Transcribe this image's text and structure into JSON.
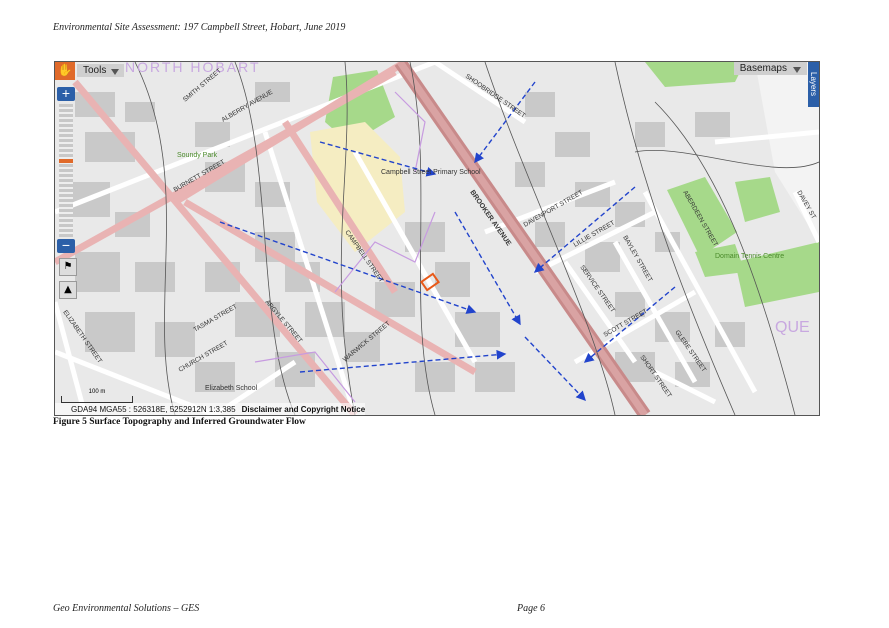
{
  "header": "Environmental Site Assessment: 197 Campbell Street, Hobart, June 2019",
  "caption": "Figure 5  Surface Topography and Inferred Groundwater Flow",
  "footer": {
    "left": "Geo Environmental Solutions – GES",
    "right": "Page 6"
  },
  "map": {
    "toolbar": {
      "tools_label": "Tools",
      "basemaps_label": "Basemaps",
      "layers_label": "Layers",
      "zoom_in": "+",
      "zoom_out": "−"
    },
    "zoom_level_fraction": 0.57,
    "status": {
      "coords": "GDA94 MGA55 : 526318E, 5252912N 1:3,385",
      "disclaimer": "Disclaimer and Copyright Notice"
    },
    "scale_label": "100 m",
    "streets": [
      "SMITH STREET",
      "ALBERRY AVENUE",
      "BURNETT STREET",
      "CAMPBELL STREET",
      "WARWICK STREET",
      "ARGYLE STREET",
      "TASMA STREET",
      "CHURCH STREET",
      "ELIZABETH STREET",
      "BROOKER AVENUE",
      "SHOOBRIDGE STREET",
      "DAVENPORT STREET",
      "LILLIE STREET",
      "SERVICE STREET",
      "BAYLEY STREET",
      "SCOTT STREET",
      "ABERDEEN STREET",
      "GLEBE STREET",
      "SHORT STREET",
      "DAVEY ST"
    ],
    "places": [
      "NORTH HOBART",
      "Soundy Park",
      "Campbell Street Primary School",
      "Elizabeth School",
      "Domain Tennis Centre",
      "QUE"
    ],
    "accent_color": "#2244cc",
    "site_color": "#e85a1a"
  }
}
